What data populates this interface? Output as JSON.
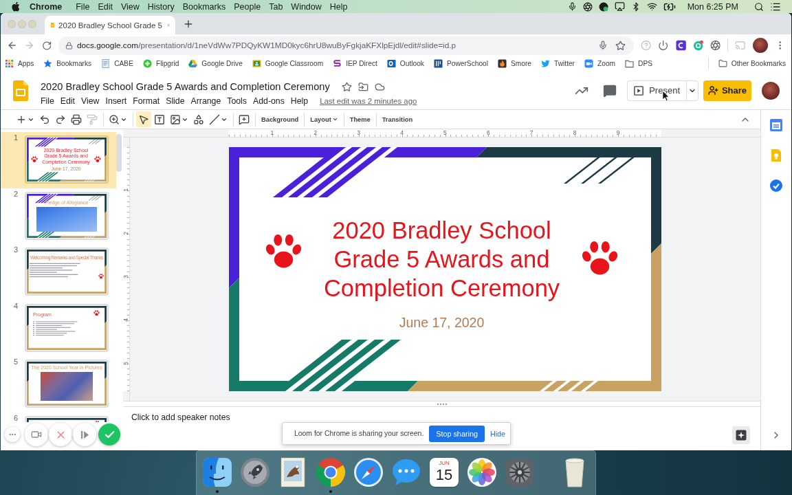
{
  "menubar": {
    "app": "Chrome",
    "menus": [
      "File",
      "Edit",
      "View",
      "History",
      "Bookmarks",
      "People",
      "Tab",
      "Window",
      "Help"
    ],
    "clock": "Mon 6:25 PM"
  },
  "browser": {
    "tab": {
      "title": "2020 Bradley School Grade 5"
    },
    "address": {
      "host": "docs.google.com",
      "path": "/presentation/d/1neVdWw7PDQyKW1MD0kyc6hrU8wuByFgkjaKFXlpEjdl/edit#slide=id.p"
    },
    "bookmarks": [
      "Apps",
      "Bookmarks",
      "CABE",
      "Flipgrid",
      "Google Drive",
      "Google Classroom",
      "IEP Direct",
      "Outlook",
      "PowerSchool",
      "Smore",
      "Twitter",
      "Zoom",
      "DPS"
    ],
    "other_bookmarks": "Other Bookmarks"
  },
  "document": {
    "title": "2020 Bradley School Grade 5 Awards and Completion Ceremony",
    "menus": [
      "File",
      "Edit",
      "View",
      "Insert",
      "Format",
      "Slide",
      "Arrange",
      "Tools",
      "Add-ons",
      "Help"
    ],
    "last_edit": "Last edit was 2 minutes ago",
    "present": "Present",
    "share": "Share"
  },
  "toolbar": {
    "tools": [
      {
        "selected": false,
        "disabled": false,
        "menu": true
      },
      {
        "selected": false,
        "disabled": false,
        "menu": false
      },
      {
        "selected": false,
        "disabled": false,
        "menu": false
      },
      {
        "selected": false,
        "disabled": false,
        "menu": false
      },
      {
        "selected": false,
        "disabled": true,
        "menu": false
      },
      {
        "selected": false,
        "disabled": false,
        "menu": true
      },
      {
        "selected": true,
        "disabled": false,
        "menu": false
      },
      {
        "selected": false,
        "disabled": false,
        "menu": false
      },
      {
        "selected": false,
        "disabled": false,
        "menu": true
      },
      {
        "selected": false,
        "disabled": false,
        "menu": false
      },
      {
        "selected": false,
        "disabled": false,
        "menu": true
      },
      {
        "selected": false,
        "disabled": false,
        "menu": false
      }
    ],
    "buttons": [
      {
        "label": "Background",
        "menu": false
      },
      {
        "label": "Layout",
        "menu": true
      },
      {
        "label": "Theme",
        "menu": false
      },
      {
        "label": "Transition",
        "menu": false
      }
    ]
  },
  "rulers": {
    "horizontal": [
      "1",
      "2",
      "3",
      "4",
      "5",
      "6",
      "7",
      "8",
      "9"
    ],
    "vertical": [
      "1",
      "2",
      "3",
      "4",
      "5"
    ]
  },
  "filmstrip": [
    {
      "number": "1",
      "selected": true,
      "kind": "title",
      "title_lines": [
        "2020 Bradley School",
        "Grade 5 Awards and",
        "Completion Ceremony"
      ],
      "subtitle": "June 17, 2020"
    },
    {
      "number": "2",
      "selected": false,
      "kind": "banner",
      "title_lines": [
        "Pledge of Allegiance"
      ]
    },
    {
      "number": "3",
      "selected": false,
      "kind": "text",
      "title_lines": [
        "Welcoming Remarks and Special Thanks"
      ]
    },
    {
      "number": "4",
      "selected": false,
      "kind": "list",
      "title_lines": [
        "Program"
      ]
    },
    {
      "number": "5",
      "selected": false,
      "kind": "picture",
      "title_lines": [
        "The 2020 School Year in Pictures"
      ]
    },
    {
      "number": "6",
      "selected": false,
      "kind": "cut"
    }
  ],
  "slide": {
    "title_lines": [
      "2020 Bradley School",
      "Grade 5 Awards and",
      "Completion Ceremony"
    ],
    "date": "June 17, 2020"
  },
  "notes": {
    "placeholder": "Click to add speaker notes"
  },
  "loom": {
    "message": "Loom for Chrome is sharing your screen.",
    "stop": "Stop sharing",
    "hide": "Hide"
  },
  "dock": {
    "apps": [
      {
        "running": true
      },
      {
        "running": false
      },
      {
        "running": false
      },
      {
        "running": true
      },
      {
        "running": false
      },
      {
        "running": false
      },
      {
        "running": false
      },
      {
        "running": false
      },
      {
        "running": false
      }
    ],
    "calendar": {
      "month": "JUN",
      "day": "15"
    }
  }
}
